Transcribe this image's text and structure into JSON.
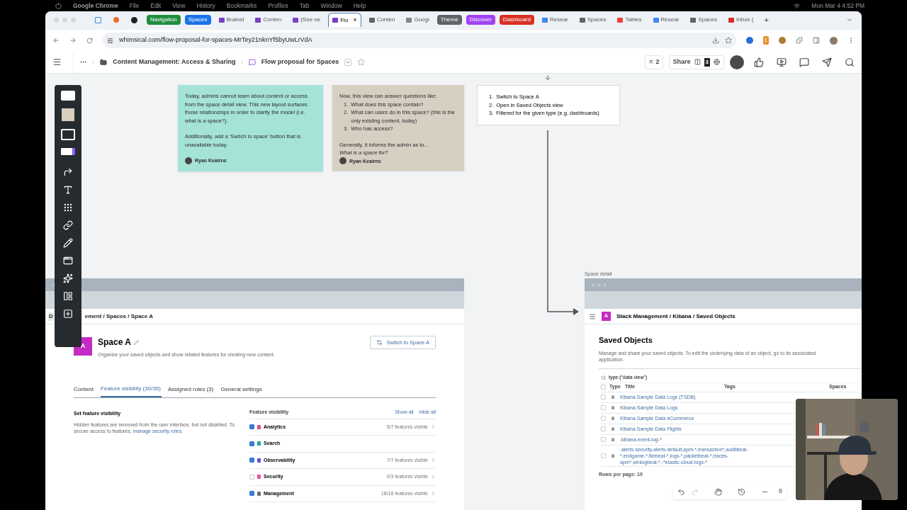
{
  "menu_bar": {
    "app": "Google Chrome",
    "items": [
      "File",
      "Edit",
      "View",
      "History",
      "Bookmarks",
      "Profiles",
      "Tab",
      "Window",
      "Help"
    ],
    "clock": "Mon Mar 4  4:52 PM"
  },
  "tabs": [
    {
      "kind": "group",
      "label": "Navigation",
      "color": "#1e8e3e",
      "selected": false
    },
    {
      "kind": "group",
      "label": "Spaces",
      "color": "#1a73e8",
      "selected": false
    },
    {
      "kind": "page",
      "label": "Brainst",
      "color": "#7b3fc4",
      "selected": false
    },
    {
      "kind": "page",
      "label": "Conten",
      "color": "#7b3fc4",
      "selected": false
    },
    {
      "kind": "page",
      "label": "(See ne",
      "color": "#7b3fc4",
      "selected": false
    },
    {
      "kind": "page",
      "label": "Flo",
      "color": "#7b3fc4",
      "selected": true,
      "close": "×"
    },
    {
      "kind": "page",
      "label": "Conten",
      "color": "#5f6368",
      "selected": false
    },
    {
      "kind": "page",
      "label": "Googl",
      "color": "#80868b",
      "selected": false
    },
    {
      "kind": "group",
      "label": "Theme",
      "color": "#5f6368",
      "selected": false
    },
    {
      "kind": "group",
      "label": "Discover",
      "color": "#a142f4",
      "selected": false
    },
    {
      "kind": "group",
      "label": "Dashboard",
      "color": "#d93025",
      "selected": false
    },
    {
      "kind": "page",
      "label": "Resear",
      "color": "#4285f4",
      "selected": false
    },
    {
      "kind": "page",
      "label": "Spaces",
      "color": "#5f6368",
      "selected": false
    },
    {
      "kind": "page",
      "label": "Tables",
      "color": "#e94235",
      "selected": false
    },
    {
      "kind": "page",
      "label": "Resear",
      "color": "#4285f4",
      "selected": false
    },
    {
      "kind": "page",
      "label": "Spaces",
      "color": "#5f6368",
      "selected": false
    },
    {
      "kind": "page",
      "label": "Inbox (",
      "color": "#d93025",
      "selected": false
    }
  ],
  "new_tab": "+",
  "url": "whimsical.com/flow-proposal-for-spaces-MrTey21nknYf5byUwLrVdA",
  "extension_badge": "1",
  "whimsical_header": {
    "separator": "/",
    "folder": "Content Management: Access & Sharing",
    "board": "Flow proposal for Spaces",
    "follow_count": "2",
    "share": "Share",
    "viewers": "3"
  },
  "notes": [
    {
      "color": "#a5e3d6",
      "paragraphs": [
        "Today, admins cannot learn about content or access from the space detail view. This new layout surfaces those relationships in order to clarify the model (i.e. what is a space?).",
        "Additionally, add a 'Swtich to space' button that is unavailable today."
      ],
      "author": "Ryan Keairns"
    },
    {
      "color": "#d6cfc2",
      "intro": "Now, this view can answer questions like:",
      "list": [
        {
          "number": "1.",
          "text": "What does this space contain?"
        },
        {
          "number": "2.",
          "text": "What can users do in this space? (this is the only existing content, today)"
        },
        {
          "number": "3.",
          "text": "Who has access?"
        }
      ],
      "outro": "Generally, it informs the admin as to...",
      "italic": "What is a space for?",
      "author": "Ryan Keairns"
    }
  ],
  "steps": [
    {
      "number": "1.",
      "text": "Switch to Space A"
    },
    {
      "number": "2.",
      "text": "Open in Saved Objects view"
    },
    {
      "number": "3.",
      "text": "Filtered for the given type (e.g. dashboards)"
    }
  ],
  "space_frame": {
    "breadcrumb_start": "D",
    "breadcrumb": "ement / Spaces / Space A",
    "avatar": "A",
    "title": "Space A",
    "subtitle": "Organize your saved objects and show related features for creating new content.",
    "switch_button": "Switch to Space A",
    "tabs": [
      {
        "label": "Content",
        "selected": false
      },
      {
        "label": "Feature visibility (30/35)",
        "selected": true
      },
      {
        "label": "Assigned roles (3)",
        "selected": false
      },
      {
        "label": "General settings",
        "selected": false
      }
    ],
    "section_title": "Set feature visibility",
    "section_text": "Hidden features are removed from the user interface, but not disabled. To secure access to features, ",
    "section_link": "manage security roles.",
    "list_title": "Feature visibility",
    "show_all": "Show all",
    "hide_all": "Hide all",
    "features": [
      {
        "name": "Analytics",
        "checked": true,
        "count": "5/7 features visible",
        "color": "#e8488b"
      },
      {
        "name": "Search",
        "checked": true,
        "color": "#1ba9a0"
      },
      {
        "name": "Observability",
        "checked": true,
        "count": "7/7 features visible",
        "color": "#6d4ad6"
      },
      {
        "name": "Security",
        "checked": false,
        "count": "0/3 features visible",
        "color": "#f04e98"
      },
      {
        "name": "Management",
        "checked": true,
        "count": "18/18 features visible",
        "color": "#69707d"
      }
    ]
  },
  "detail_frame": {
    "label": "Space detail",
    "avatar": "A",
    "breadcrumb": "Stack Management / Kibana / Saved Objects",
    "title": "Saved Objects",
    "description": "Manage and share your saved objects. To edit the underlying data of an object, go to its associated application.",
    "search": "type:(\"data view\")",
    "columns": [
      "Type",
      "Title",
      "Tags",
      "Spaces"
    ],
    "select_all_checked": false,
    "rows": [
      {
        "title": "Kibana Sample Data Logs (TSDB)",
        "checked": false
      },
      {
        "title": "Kibana Sample Data Logs",
        "checked": false
      },
      {
        "title": "Kibana Sample Data eCommerce",
        "checked": false
      },
      {
        "title": "Kibana Sample Data Flights",
        "checked": false
      },
      {
        "title": ".kibana-event-log-*",
        "checked": false
      },
      {
        "title": ".alerts-security.alerts-default,apm-*-transaction*,auditbeat-*,endgame-*,filebeat-*,logs-*,packetbeat-*,traces-apm*,winlogbeat-*,-*elastic-cloud-logs-*",
        "checked": false
      }
    ],
    "rows_per_page": "Rows per page: 10"
  },
  "zoom_level": "8"
}
